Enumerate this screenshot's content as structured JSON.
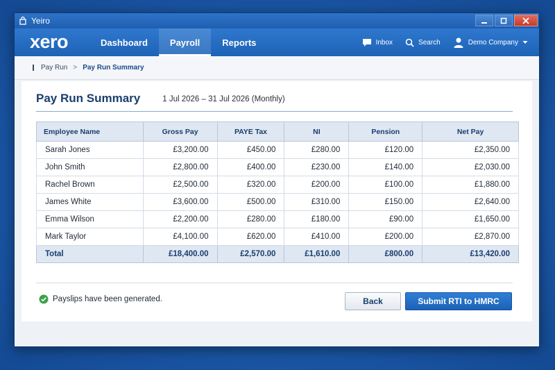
{
  "window": {
    "title": "Yeiro"
  },
  "nav": {
    "logo": "xero",
    "tabs": [
      {
        "label": "Dashboard",
        "active": false
      },
      {
        "label": "Payroll",
        "active": true
      },
      {
        "label": "Reports",
        "active": false
      }
    ],
    "inbox_label": "Inbox",
    "search_label": "Search",
    "org_label": "Demo Company"
  },
  "breadcrumb": {
    "parent": "Pay Run",
    "separator": ">",
    "current": "Pay Run Summary"
  },
  "page": {
    "title": "Pay Run Summary",
    "date_range": "1 Jul 2026 – 31 Jul 2026 (Monthly)"
  },
  "table": {
    "headers": [
      "Employee Name",
      "Gross Pay",
      "PAYE Tax",
      "NI",
      "Pension",
      "Net Pay"
    ],
    "rows": [
      [
        "Sarah Jones",
        "£3,200.00",
        "£450.00",
        "£280.00",
        "£120.00",
        "£2,350.00"
      ],
      [
        "John Smith",
        "£2,800.00",
        "£400.00",
        "£230.00",
        "£140.00",
        "£2,030.00"
      ],
      [
        "Rachel Brown",
        "£2,500.00",
        "£320.00",
        "£200.00",
        "£100.00",
        "£1,880.00"
      ],
      [
        "James White",
        "£3,600.00",
        "£500.00",
        "£310.00",
        "£150.00",
        "£2,640.00"
      ],
      [
        "Emma Wilson",
        "£2,200.00",
        "£280.00",
        "£180.00",
        "£90.00",
        "£1,650.00"
      ],
      [
        "Mark Taylor",
        "£4,100.00",
        "£620.00",
        "£410.00",
        "£200.00",
        "£2,870.00"
      ]
    ],
    "total": [
      "Total",
      "£18,400.00",
      "£2,570.00",
      "£1,610.00",
      "£800.00",
      "£13,420.00"
    ]
  },
  "status": {
    "message": "Payslips have been generated.",
    "color": "#3aa34a"
  },
  "actions": {
    "back_label": "Back",
    "submit_label": "Submit RTI to HMRC"
  },
  "colors": {
    "brand": "#1d63b6",
    "accent": "#1a3e6e"
  }
}
